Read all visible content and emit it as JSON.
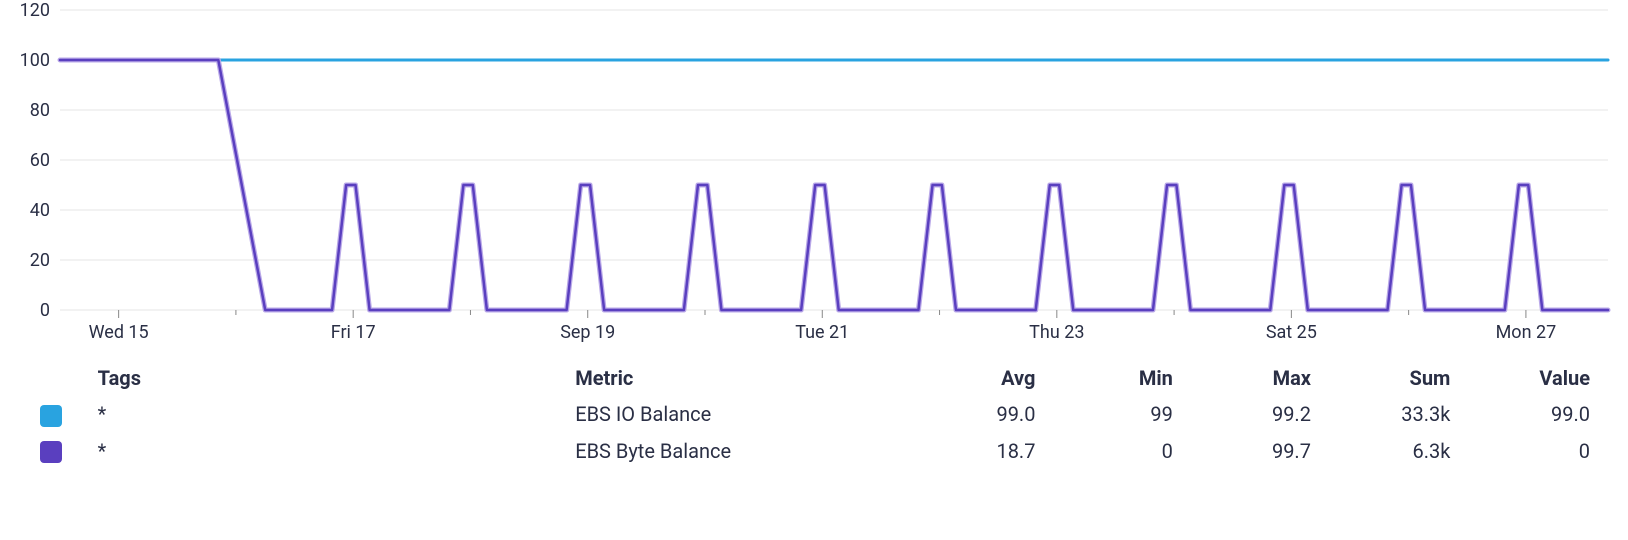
{
  "chart_data": {
    "type": "line",
    "ylabel": "",
    "xlabel": "",
    "ylim": [
      0,
      120
    ],
    "yticks": [
      0,
      20,
      40,
      60,
      80,
      100,
      120
    ],
    "x_categories": [
      "Wed 15",
      "Fri 17",
      "Sep 19",
      "Tue 21",
      "Thu 23",
      "Sat 25",
      "Mon 27"
    ],
    "series": [
      {
        "name": "EBS IO Balance",
        "color": "#29a3e0",
        "pattern": "flat",
        "values": [
          100,
          100,
          100,
          100,
          100,
          100,
          100,
          100,
          100,
          100,
          100,
          100,
          100,
          100
        ]
      },
      {
        "name": "EBS Byte Balance",
        "color": "#5a3fbf",
        "pattern": "drop_then_spikes",
        "initial_value": 100,
        "drop_at_day_index": 1.5,
        "baseline_after_drop": 0,
        "spike_peak": 50,
        "spike_count": 11
      }
    ]
  },
  "legend": {
    "headers": {
      "tags": "Tags",
      "metric": "Metric",
      "avg": "Avg",
      "min": "Min",
      "max": "Max",
      "sum": "Sum",
      "value": "Value"
    },
    "rows": [
      {
        "color": "#29a3e0",
        "tags": "*",
        "metric": "EBS IO Balance",
        "avg": "99.0",
        "min": "99",
        "max": "99.2",
        "sum": "33.3k",
        "value": "99.0"
      },
      {
        "color": "#5a3fbf",
        "tags": "*",
        "metric": "EBS Byte Balance",
        "avg": "18.7",
        "min": "0",
        "max": "99.7",
        "sum": "6.3k",
        "value": "0"
      }
    ]
  }
}
